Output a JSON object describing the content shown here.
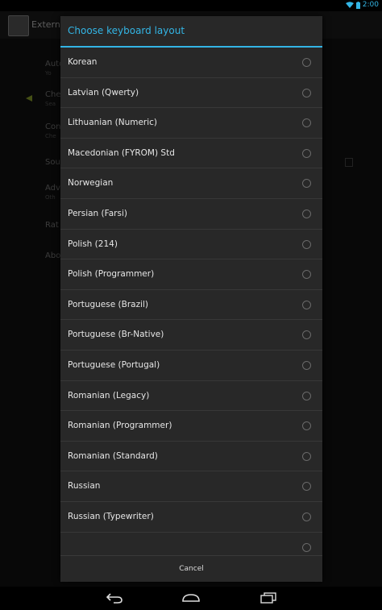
{
  "status_bar": {
    "time": "2:00"
  },
  "app": {
    "title": "Externe"
  },
  "background_items": [
    {
      "label": "Auto",
      "sub": "Yo"
    },
    {
      "label": "Che",
      "sub": "Sea"
    },
    {
      "label": "Con",
      "sub": "Che"
    },
    {
      "label": "Sou",
      "sub": ""
    },
    {
      "label": "Adv",
      "sub": "Oth"
    },
    {
      "label": "Rat",
      "sub": ""
    },
    {
      "label": "Abo",
      "sub": ""
    }
  ],
  "dialog": {
    "title": "Choose keyboard layout",
    "options": [
      "Korean",
      "Latvian (Qwerty)",
      "Lithuanian (Numeric)",
      "Macedonian (FYROM) Std",
      "Norwegian",
      "Persian (Farsi)",
      "Polish (214)",
      "Polish (Programmer)",
      "Portuguese (Brazil)",
      "Portuguese (Br-Native)",
      "Portuguese (Portugal)",
      "Romanian (Legacy)",
      "Romanian (Programmer)",
      "Romanian (Standard)",
      "Russian",
      "Russian (Typewriter)",
      ""
    ],
    "cancel_label": "Cancel"
  },
  "colors": {
    "accent": "#33b5e5",
    "dialog_bg": "#282828"
  }
}
